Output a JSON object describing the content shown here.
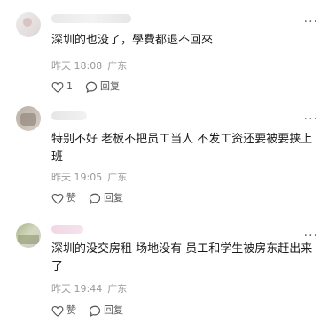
{
  "comments": [
    {
      "text": "深圳的也没了，學費都退不回來",
      "time": "昨天 18:08",
      "location": "广东",
      "like_label": "1",
      "reply_label": "回复",
      "more_label": "···"
    },
    {
      "text": "特别不好 老板不把员工当人 不发工资还要被要挟上班",
      "time": "昨天 19:05",
      "location": "广东",
      "like_label": "赞",
      "reply_label": "回复",
      "more_label": "···"
    },
    {
      "text": "深圳的没交房租 场地没有 员工和学生被房东赶出来了",
      "time": "昨天 19:44",
      "location": "广东",
      "like_label": "赞",
      "reply_label": "回复",
      "more_label": "···"
    }
  ]
}
